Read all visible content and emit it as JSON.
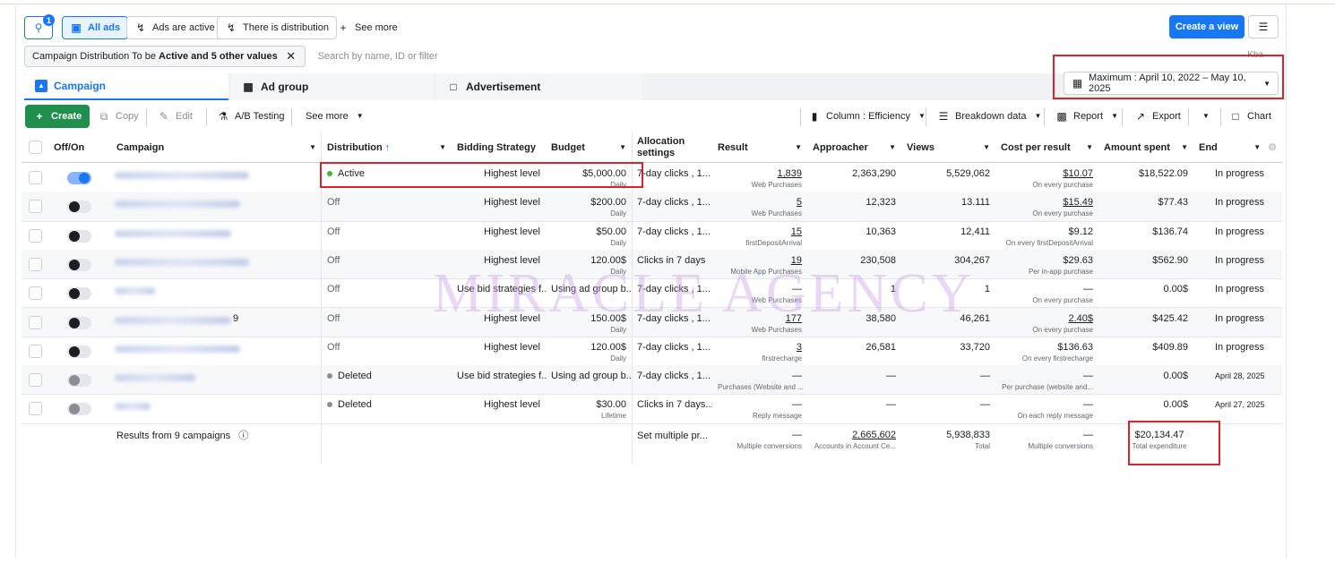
{
  "toolbar": {
    "notif_count": "1",
    "all_ads": "All ads",
    "ads_active": "Ads are active",
    "distribution": "There is distribution",
    "see_more": "See more",
    "create_view": "Create a view"
  },
  "filter": {
    "chip_prefix": "Campaign Distribution To be",
    "chip_bold": "Active and 5 other values",
    "search_placeholder": "Search by name, ID or filter",
    "kba": "Kba"
  },
  "tabs": [
    {
      "label": "Campaign"
    },
    {
      "label": "Ad group"
    },
    {
      "label": "Advertisement"
    }
  ],
  "date_range": "Maximum : April 10, 2022 – May 10, 2025",
  "actions": {
    "create": "Create",
    "copy": "Copy",
    "edit": "Edit",
    "ab": "A/B Testing",
    "see_more": "See more",
    "columns": "Column : Efficiency",
    "breakdown": "Breakdown data",
    "report": "Report",
    "export": "Export",
    "chart": "Chart"
  },
  "columns": {
    "onoff": "Off/On",
    "campaign": "Campaign",
    "distribution": "Distribution",
    "bidding": "Bidding Strategy",
    "budget": "Budget",
    "allocation": "Allocation settings",
    "result": "Result",
    "approacher": "Approacher",
    "views": "Views",
    "cpr": "Cost per result",
    "spent": "Amount spent",
    "end": "End"
  },
  "rows": [
    {
      "toggle": "on",
      "name_tail": "",
      "dist": "Active",
      "dist_color": "#42b72a",
      "bid": "Highest level",
      "budget": "$5,000.00",
      "budget_sub": "Daily",
      "alloc": "7-day clicks , 1...",
      "result": "1,839",
      "result_sub": "Web Purchases",
      "approacher": "2,363,290",
      "views": "5,529,062",
      "cpr": "$10.07",
      "cpr_sub": "On every purchase",
      "spent": "$18,522.09",
      "end": "In progress"
    },
    {
      "toggle": "off",
      "name_tail": "",
      "dist": "Off",
      "dist_color": "",
      "bid": "Highest level",
      "budget": "$200.00",
      "budget_sub": "Daily",
      "alloc": "7-day clicks , 1...",
      "result": "5",
      "result_sub": "Web Purchases",
      "approacher": "12,323",
      "views": "13.111",
      "cpr": "$15.49",
      "cpr_sub": "On every purchase",
      "spent": "$77.43",
      "end": "In progress"
    },
    {
      "toggle": "off",
      "name_tail": "",
      "dist": "Off",
      "dist_color": "",
      "bid": "Highest level",
      "budget": "$50.00",
      "budget_sub": "Daily",
      "alloc": "7-day clicks , 1...",
      "result": "15",
      "result_sub": "firstDepositArrival",
      "approacher": "10,363",
      "views": "12,411",
      "cpr": "$9.12",
      "cpr_sub": "On every firstDepositArrival",
      "spent": "$136.74",
      "end": "In progress"
    },
    {
      "toggle": "off",
      "name_tail": "",
      "dist": "Off",
      "dist_color": "",
      "bid": "Highest level",
      "budget": "120.00$",
      "budget_sub": "Daily",
      "alloc": "Clicks in 7 days",
      "result": "19",
      "result_sub": "Mobile App Purchases",
      "approacher": "230,508",
      "views": "304,267",
      "cpr": "$29.63",
      "cpr_sub": "Per in-app purchase",
      "spent": "$562.90",
      "end": "In progress"
    },
    {
      "toggle": "off",
      "name_tail": "",
      "dist": "Off",
      "dist_color": "",
      "bid": "Use bid strategies f...",
      "budget": "Using ad group b...",
      "budget_sub": "",
      "alloc": "7-day clicks , 1...",
      "result": "—",
      "result_sub": "Web Purchases",
      "approacher": "1",
      "views": "1",
      "cpr": "—",
      "cpr_sub": "On every purchase",
      "spent": "0.00$",
      "end": "In progress"
    },
    {
      "toggle": "off",
      "name_tail": "9",
      "dist": "Off",
      "dist_color": "",
      "bid": "Highest level",
      "budget": "150.00$",
      "budget_sub": "Daily",
      "alloc": "7-day clicks , 1...",
      "result": "177",
      "result_sub": "Web Purchases",
      "approacher": "38,580",
      "views": "46,261",
      "cpr": "2.40$",
      "cpr_sub": "On every purchase",
      "spent": "$425.42",
      "end": "In progress"
    },
    {
      "toggle": "off",
      "name_tail": "",
      "dist": "Off",
      "dist_color": "",
      "bid": "Highest level",
      "budget": "120.00$",
      "budget_sub": "Daily",
      "alloc": "7-day clicks , 1...",
      "result": "3",
      "result_sub": "firstrecharge",
      "approacher": "26,581",
      "views": "33,720",
      "cpr": "$136.63",
      "cpr_sub": "On every firstrecharge",
      "spent": "$409.89",
      "end": "In progress"
    },
    {
      "toggle": "dis",
      "name_tail": "",
      "dist": "Deleted",
      "dist_color": "#8a8d91",
      "bid": "Use bid strategies f...",
      "budget": "Using ad group b...",
      "budget_sub": "",
      "alloc": "7-day clicks , 1...",
      "result": "—",
      "result_sub": "Purchases (Website and ...",
      "approacher": "—",
      "views": "—",
      "cpr": "—",
      "cpr_sub": "Per purchase (website and...",
      "spent": "0.00$",
      "end": "April 28, 2025"
    },
    {
      "toggle": "dis",
      "name_tail": "",
      "dist": "Deleted",
      "dist_color": "#8a8d91",
      "bid": "Highest level",
      "budget": "$30.00",
      "budget_sub": "Lifetime",
      "alloc": "Clicks in 7 days...",
      "result": "—",
      "result_sub": "Reply message",
      "approacher": "—",
      "views": "—",
      "cpr": "—",
      "cpr_sub": "On each reply message",
      "spent": "0.00$",
      "end": "April 27, 2025"
    }
  ],
  "summary": {
    "label": "Results from 9 campaigns",
    "alloc": "Set multiple pr...",
    "result": "—",
    "result_sub": "Multiple conversions",
    "approacher": "2,665,602",
    "approacher_sub": "Accounts in Account Ce...",
    "views": "5,938,833",
    "views_sub": "Total",
    "cpr": "—",
    "cpr_sub": "Multiple conversions",
    "spent": "$20,134.47",
    "spent_sub": "Total expenditure"
  },
  "watermark": "MIRACLE AGENCY",
  "colors": {
    "accent": "#1877f2",
    "create": "#1f8f4e",
    "highlight": "#e0202a"
  }
}
